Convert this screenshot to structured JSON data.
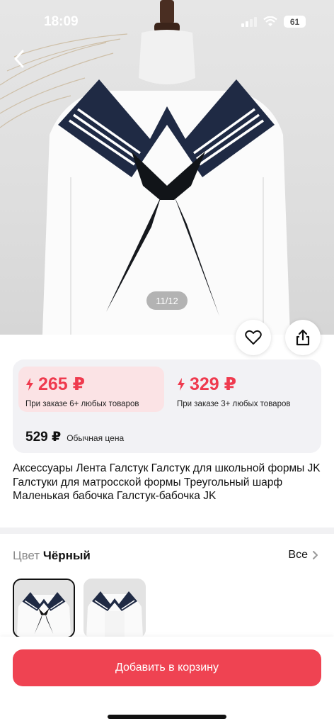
{
  "status_bar": {
    "time": "18:09",
    "battery": "61"
  },
  "gallery": {
    "counter": "11/12"
  },
  "prices": {
    "tier1_price": "265 ₽",
    "tier1_condition": "При заказе 6+ любых товаров",
    "tier2_price": "329 ₽",
    "tier2_condition": "При заказе 3+ любых товаров",
    "regular_price": "529 ₽",
    "regular_label": "Обычная цена"
  },
  "product": {
    "title": "Аксессуары Лента Галстук Галстук для школьной формы JK Галстуки для матросской формы Треугольный шарф Маленькая бабочка Галстук-бабочка JK"
  },
  "color_selector": {
    "label": "Цвет",
    "value": "Чёрный",
    "see_all": "Все"
  },
  "cta": {
    "add_to_cart": "Добавить в корзину"
  },
  "colors": {
    "accent": "#ef4352",
    "price_red": "#ef3a4e",
    "tier_bg": "#fbe3e5",
    "card_bg": "#f2f2f5",
    "collar_navy": "#1f2a44"
  },
  "icons": [
    "back-chevron-icon",
    "heart-icon",
    "share-icon",
    "lightning-icon",
    "chevron-right-icon",
    "signal-icon",
    "wifi-icon",
    "battery-icon"
  ]
}
